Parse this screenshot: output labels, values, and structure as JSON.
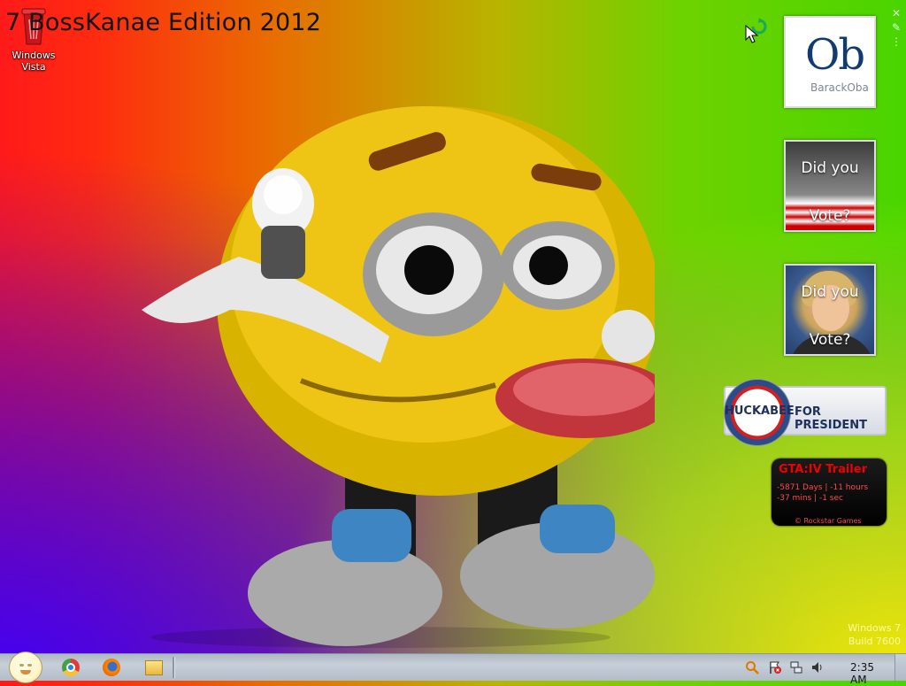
{
  "desktop": {
    "title": "7 BossKanae Edition 2012",
    "icons": [
      {
        "label_line1": "Windows",
        "label_line2": "Vista",
        "icon": "recycle-bin-icon"
      }
    ]
  },
  "gadgets": {
    "obama": {
      "big": "Ob",
      "small": "BarackOba"
    },
    "vote1": {
      "line1": "Did you",
      "line2": "Vote?"
    },
    "vote2": {
      "line1": "Did you",
      "line2": "Vote?"
    },
    "huckabee": {
      "name": "HUCKABEE",
      "tagline": "FOR PRESIDENT"
    },
    "gta": {
      "title": "GTA:IV Trailer",
      "line1": "-5871 Days | -11 hours",
      "line2": "-37 mins | -1 sec",
      "credit": "© Rockstar Games"
    }
  },
  "watermark": {
    "line1": "Windows 7",
    "line2": "Build 7600"
  },
  "taskbar": {
    "pinned": [
      "chrome-icon",
      "firefox-icon",
      "explorer-icon"
    ],
    "tray": [
      "search-icon",
      "action-center-flag-icon",
      "network-icon",
      "volume-icon"
    ],
    "clock": "2:35 AM"
  },
  "colors": {
    "accent_red": "#e00000",
    "gadget_blue": "#123b72"
  }
}
